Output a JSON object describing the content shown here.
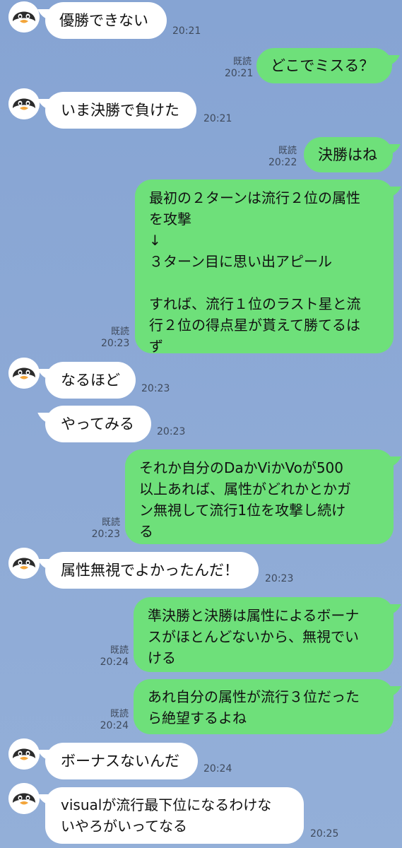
{
  "chat": {
    "read_label": "既読",
    "messages": [
      {
        "side": "in",
        "text": "優勝できない",
        "time": "20:21"
      },
      {
        "side": "out",
        "text": "どこでミスる？",
        "time": "20:21"
      },
      {
        "side": "in",
        "text": "いま決勝で負けた",
        "time": "20:21"
      },
      {
        "side": "out",
        "text": "決勝はね",
        "time": "20:22"
      },
      {
        "side": "out",
        "text": "最初の２ターンは流行２位の属性\nを攻撃\n↓\n３ターン目に思い出アピール\n\nすれば、流行１位のラスト星と流\n行２位の得点星が貰えて勝てるは\nず",
        "time": "20:23"
      },
      {
        "side": "in",
        "text": "なるほど",
        "time": "20:23"
      },
      {
        "side": "in",
        "text": "やってみる",
        "time": "20:23"
      },
      {
        "side": "out",
        "text": "それか自分のDaかViかVoが500\n以上あれば、属性がどれかとかガ\nン無視して流行1位を攻撃し続け\nる",
        "time": "20:23"
      },
      {
        "side": "in",
        "text": "属性無視でよかったんだ！",
        "time": "20:23"
      },
      {
        "side": "out",
        "text": "準決勝と決勝は属性によるボーナ\nスがほとんどないから、無視でい\nける",
        "time": "20:24"
      },
      {
        "side": "out",
        "text": "あれ自分の属性が流行３位だった\nら絶望するよね",
        "time": "20:24"
      },
      {
        "side": "in",
        "text": "ボーナスないんだ",
        "time": "20:24"
      },
      {
        "side": "in",
        "text": "visualが流行最下位になるわけな\nいやろがいってなる",
        "time": "20:25"
      }
    ]
  }
}
